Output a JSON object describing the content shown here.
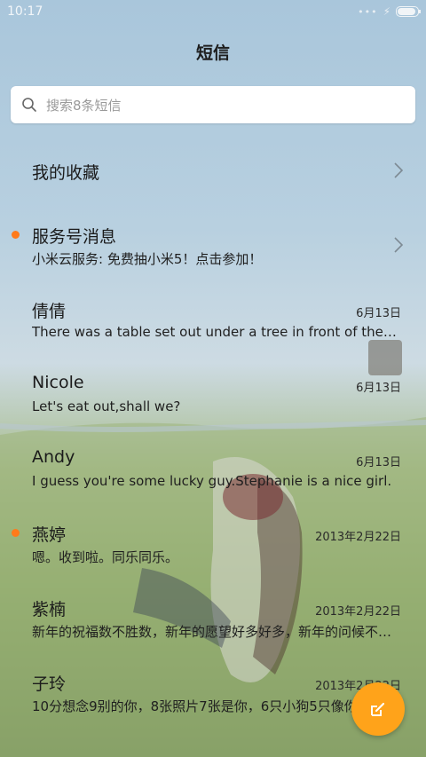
{
  "status_bar": {
    "time": "10:17",
    "icons": [
      "signal-dots-icon",
      "charging-bolt-icon",
      "battery-icon"
    ],
    "battery_level": 0.9
  },
  "header": {
    "title": "短信"
  },
  "search": {
    "placeholder": "搜索8条短信",
    "icon": "search-icon"
  },
  "favorites": {
    "label": "我的收藏"
  },
  "conversations": [
    {
      "name": "服务号消息",
      "preview": "小米云服务: 免费抽小米5！点击参加！",
      "date": "",
      "unread": true,
      "chevron": true
    },
    {
      "name": "倩倩",
      "preview": "There was a table set out under a tree in front of the house, and the March Hare",
      "date": "6月13日",
      "unread": false
    },
    {
      "name": "Nicole",
      "preview": "Let's eat out,shall we?",
      "date": "6月13日",
      "unread": false
    },
    {
      "name": "Andy",
      "preview": "I guess you're some lucky guy.Stephanie is a nice girl.",
      "date": "6月13日",
      "unread": false
    },
    {
      "name": "燕婷",
      "preview": "嗯。收到啦。同乐同乐。",
      "date": "2013年2月22日",
      "unread": true
    },
    {
      "name": "紫楠",
      "preview": "新年的祝福数不胜数，新年的愿望好多好多，新年的问候不能少",
      "date": "2013年2月22日",
      "unread": false
    },
    {
      "name": "子玲",
      "preview": "10分想念9别的你，8张照片7张是你，6只小狗5只像你",
      "date": "2013年2月22日",
      "unread": false
    }
  ],
  "compose": {
    "icon": "compose-pencil-icon"
  },
  "colors": {
    "accent": "#ffa31a",
    "unread_dot": "#ff7a1a"
  }
}
